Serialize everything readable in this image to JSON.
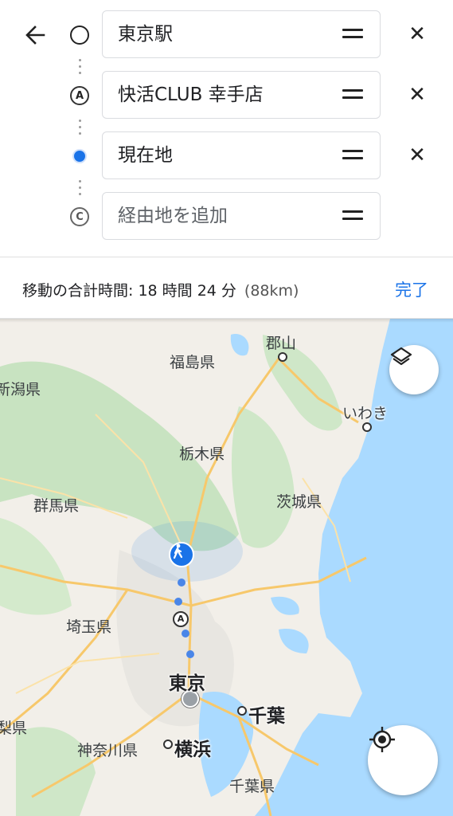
{
  "header": {
    "back_icon": "arrow-left-icon"
  },
  "stops": [
    {
      "marker": "circle-outline",
      "text": "東京駅",
      "placeholder": false,
      "removable": true
    },
    {
      "marker": "A",
      "text": "快活CLUB 幸手店",
      "placeholder": false,
      "removable": true
    },
    {
      "marker": "current-location-dot",
      "text": "現在地",
      "placeholder": false,
      "removable": true
    },
    {
      "marker": "C",
      "text": "経由地を追加",
      "placeholder": true,
      "removable": false
    }
  ],
  "summary": {
    "label": "移動の合計時間: 18 時間 24 分",
    "distance": "(88km)",
    "done_label": "完了"
  },
  "map": {
    "labels": {
      "koriyama": "郡山",
      "fukushima": "福島県",
      "niigata": "新潟県",
      "iwaki": "いわき",
      "tochigi": "栃木県",
      "gunma": "群馬県",
      "ibaraki": "茨城県",
      "saitama": "埼玉県",
      "tokyo": "東京",
      "chiba_city": "千葉",
      "yamanashi": "梨県",
      "kanagawa": "神奈川県",
      "yokohama": "横浜",
      "chiba_pref": "千葉県"
    },
    "route_marker": "A",
    "colors": {
      "sea": "#aadaff",
      "land": "#f2efe9",
      "forest": "#c8e3c1",
      "urban": "#e8e6e1",
      "road": "#f7c86b",
      "route": "#1a73e8"
    }
  },
  "buttons": {
    "layers_icon": "layers-icon",
    "location_icon": "my-location-icon"
  }
}
